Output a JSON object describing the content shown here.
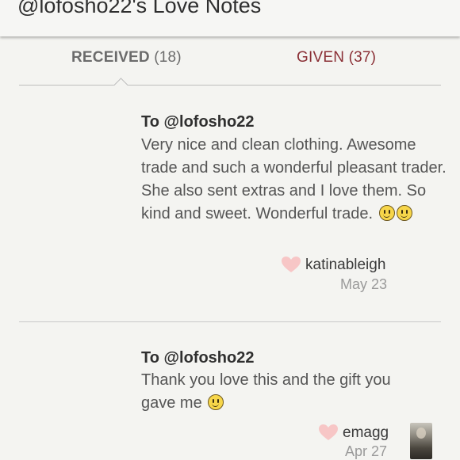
{
  "header": {
    "title": "@lofosho22's Love Notes"
  },
  "tabs": {
    "received": {
      "label": "RECEIVED",
      "count": "(18)"
    },
    "given": {
      "label": "GIVEN",
      "count": "(37)"
    }
  },
  "notes": [
    {
      "to": "To @lofosho22",
      "body": "Very nice and clean clothing. Awesome trade and such a wonderful pleasant trader. She also sent extras and I love them. So kind and sweet. Wonderful trade.",
      "emoji_count": 2,
      "giver": "katinableigh",
      "date": "May 23"
    },
    {
      "to": "To @lofosho22",
      "body": "Thank you love this and the gift you gave me",
      "emoji_count": 1,
      "giver": "emagg",
      "date": "Apr 27"
    }
  ],
  "colors": {
    "accent": "#8a2f35",
    "heart": "#f7c6c6",
    "background": "#f4f4f1"
  },
  "icons": [
    "heart-icon",
    "smiley-emoji-icon"
  ]
}
